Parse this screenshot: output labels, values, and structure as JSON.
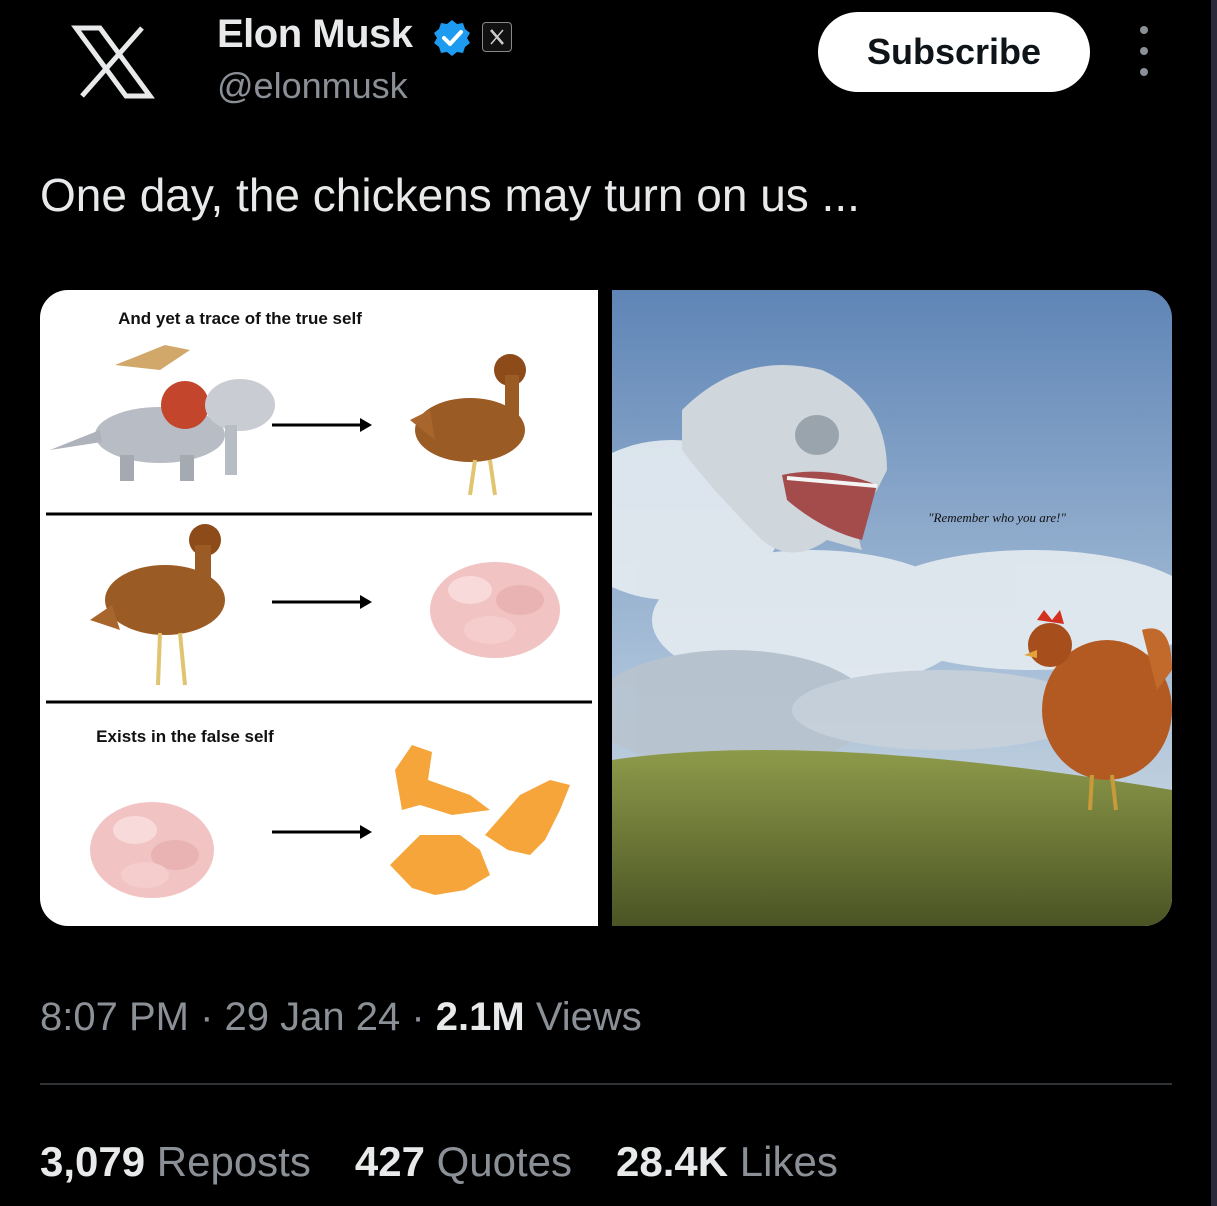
{
  "header": {
    "display_name": "Elon Musk",
    "handle": "@elonmusk",
    "subscribe_label": "Subscribe",
    "icons": [
      "x-logo-icon",
      "verified-badge-icon",
      "affiliation-x-icon",
      "more-icon"
    ]
  },
  "tweet": {
    "text": "One day, the chickens may turn on us ..."
  },
  "media": {
    "left_panel": {
      "top_caption": "And yet a trace of the true self",
      "bottom_caption": "Exists in the false self"
    },
    "right_panel": {
      "quote": "\"Remember who you are!\""
    }
  },
  "meta": {
    "time": "8:07 PM",
    "sep1": " · ",
    "date": "29 Jan 24",
    "sep2": " · ",
    "views_count": "2.1M",
    "views_label": " Views"
  },
  "stats": {
    "reposts_count": "3,079",
    "reposts_label": " Reposts",
    "quotes_count": "427",
    "quotes_label": " Quotes",
    "likes_count": "28.4K",
    "likes_label": " Likes"
  },
  "colors": {
    "background": "#000000",
    "text_primary": "#e7e9ea",
    "text_secondary": "#8b9096",
    "verified": "#1d9bf0",
    "button_bg": "#ffffff"
  }
}
